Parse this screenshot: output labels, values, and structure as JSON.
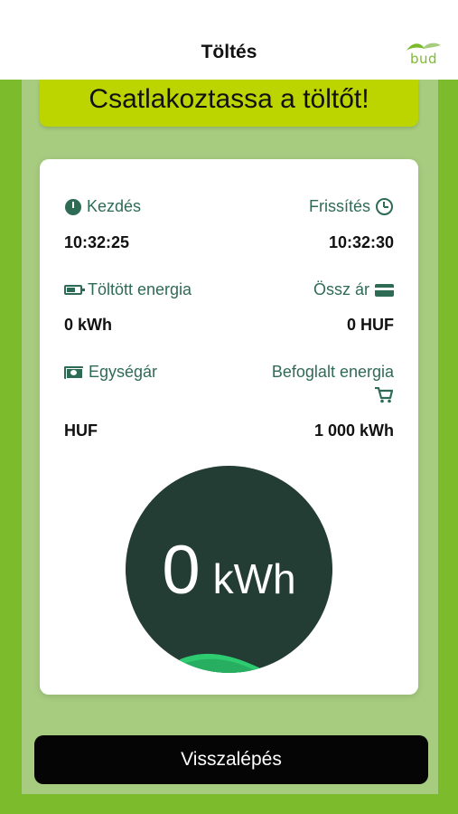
{
  "header": {
    "title": "Töltés",
    "logo_text": "bud"
  },
  "banner": {
    "text": "Csatlakoztassa a töltőt!"
  },
  "fields": {
    "start": {
      "label": "Kezdés",
      "value": "10:32:25",
      "icon": "clock-icon"
    },
    "refresh": {
      "label": "Frissítés",
      "value": "10:32:30",
      "icon": "alarm-icon"
    },
    "charged_energy": {
      "label": "Töltött energia",
      "value": "0 kWh",
      "icon": "battery-icon"
    },
    "total_price": {
      "label": "Össz ár",
      "value": "0 HUF",
      "icon": "credit-card-icon"
    },
    "unit_price": {
      "label": "Egységár",
      "value": "HUF",
      "icon": "money-icon"
    },
    "reserved_energy": {
      "label": "Befoglalt energia",
      "value": "1 000 kWh",
      "icon": "cart-icon"
    }
  },
  "gauge": {
    "value": "0",
    "unit": "kWh"
  },
  "footer": {
    "back_label": "Visszalépés"
  },
  "colors": {
    "brand_green": "#7cbc2c",
    "banner": "#bcd400",
    "label_text": "#2e6b55",
    "gauge_bg": "#233c34",
    "wave": "#2ecc71"
  }
}
